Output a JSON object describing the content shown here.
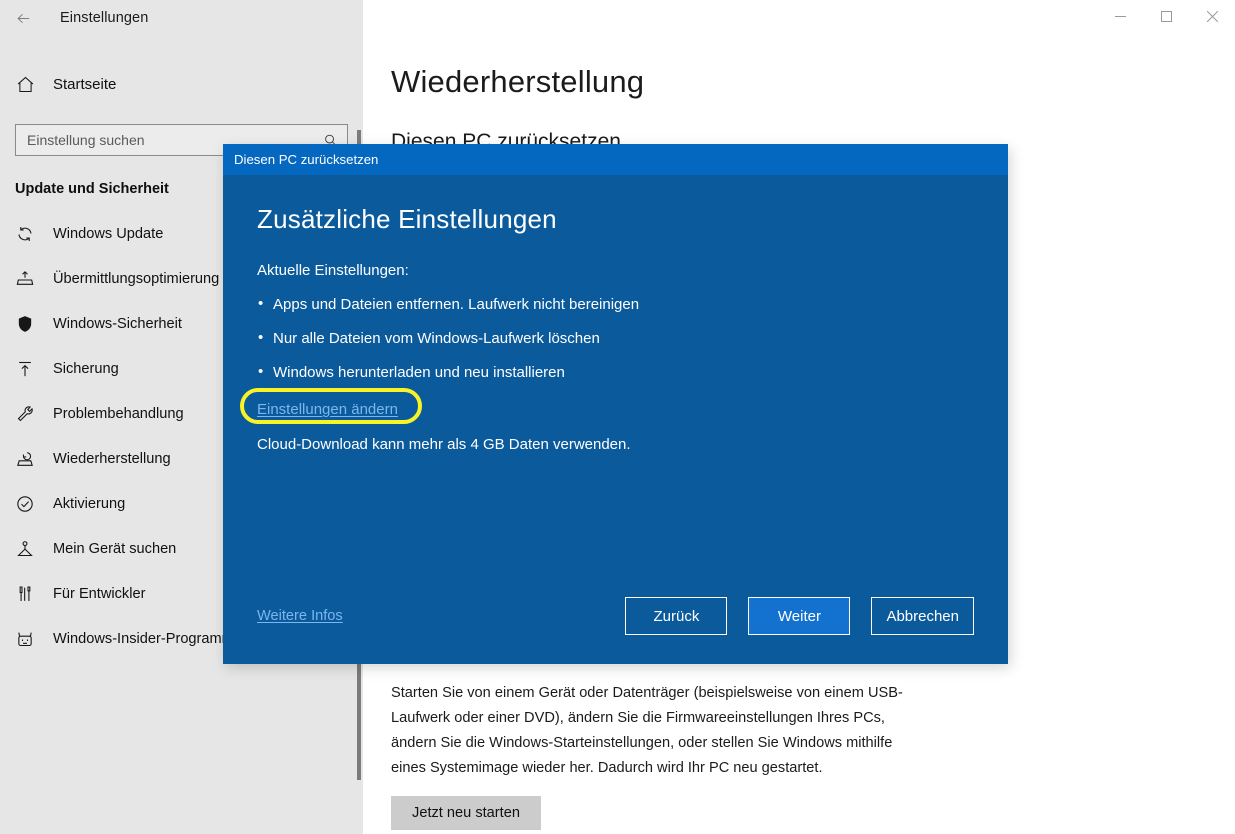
{
  "window": {
    "title": "Einstellungen",
    "back_icon": "back-arrow-icon",
    "controls": {
      "minimize": "minimize-icon",
      "maximize": "maximize-icon",
      "close": "close-icon"
    }
  },
  "sidebar": {
    "home": {
      "label": "Startseite",
      "icon": "home-icon"
    },
    "search": {
      "placeholder": "Einstellung suchen",
      "value": "",
      "icon": "search-icon"
    },
    "group_title": "Update und Sicherheit",
    "items": [
      {
        "label": "Windows Update",
        "icon": "refresh-icon"
      },
      {
        "label": "Übermittlungsoptimierung",
        "icon": "upload-tray-icon"
      },
      {
        "label": "Windows-Sicherheit",
        "icon": "shield-icon"
      },
      {
        "label": "Sicherung",
        "icon": "backup-upload-icon"
      },
      {
        "label": "Problembehandlung",
        "icon": "wrench-icon"
      },
      {
        "label": "Wiederherstellung",
        "icon": "recovery-icon"
      },
      {
        "label": "Aktivierung",
        "icon": "check-circle-icon"
      },
      {
        "label": "Mein Gerät suchen",
        "icon": "find-device-icon"
      },
      {
        "label": "Für Entwickler",
        "icon": "developer-tools-icon"
      },
      {
        "label": "Windows-Insider-Programm",
        "icon": "insider-cat-icon"
      }
    ]
  },
  "main": {
    "page_title": "Wiederherstellung",
    "section_heading": "Diesen PC zurücksetzen",
    "advanced_text": "Starten Sie von einem Gerät oder Datenträger (beispielsweise von einem USB-Laufwerk oder einer DVD), ändern Sie die Firmwareeinstellungen Ihres PCs, ändern Sie die Windows-Starteinstellungen, oder stellen Sie Windows mithilfe eines Systemimage wieder her. Dadurch wird Ihr PC neu gestartet.",
    "restart_button": "Jetzt neu starten"
  },
  "dialog": {
    "titlebar": "Diesen PC zurücksetzen",
    "heading": "Zusätzliche Einstellungen",
    "subheading": "Aktuelle Einstellungen:",
    "bullets": [
      "Apps und Dateien entfernen. Laufwerk nicht bereinigen",
      "Nur alle Dateien vom Windows-Laufwerk löschen",
      "Windows herunterladen und neu installieren"
    ],
    "change_settings_link": "Einstellungen ändern",
    "note": "Cloud-Download kann mehr als 4 GB Daten verwenden.",
    "more_info_link": "Weitere Infos",
    "buttons": {
      "back": "Zurück",
      "next": "Weiter",
      "cancel": "Abbrechen"
    }
  },
  "colors": {
    "dialog_body": "#0b5a9c",
    "dialog_titlebar": "#0568c0",
    "accent_link": "#7bb7ee",
    "highlight": "#f8f327",
    "primary_button": "#1372d0",
    "sidebar_bg": "#e6e6e6"
  }
}
